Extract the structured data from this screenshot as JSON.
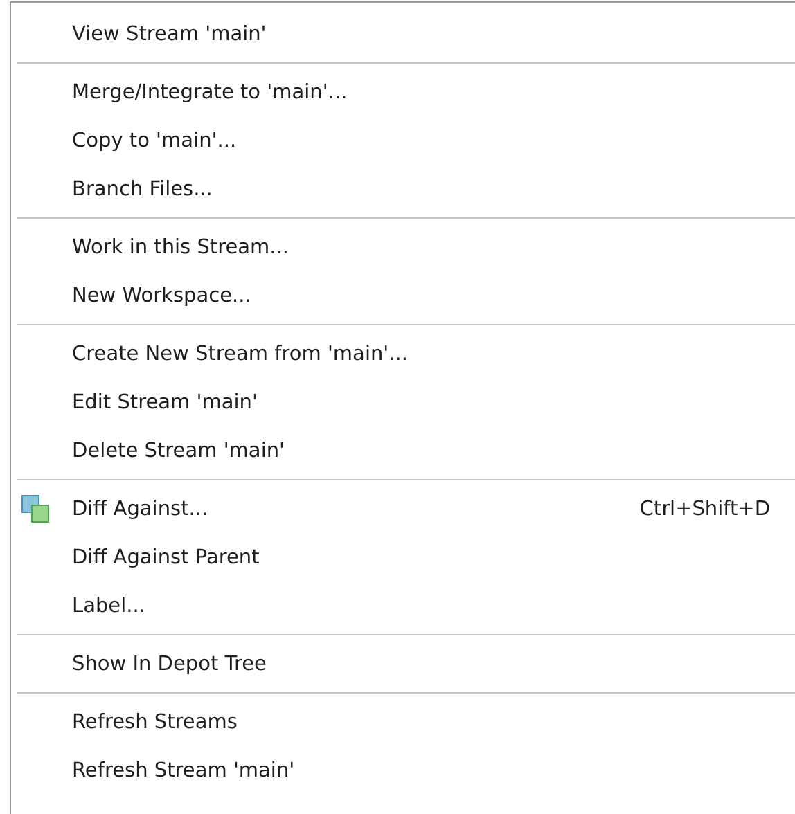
{
  "menu": {
    "items": [
      {
        "kind": "item",
        "label": "View Stream 'main'"
      },
      {
        "kind": "separator"
      },
      {
        "kind": "item",
        "label": "Merge/Integrate to 'main'..."
      },
      {
        "kind": "item",
        "label": "Copy to 'main'..."
      },
      {
        "kind": "item",
        "label": "Branch Files..."
      },
      {
        "kind": "separator"
      },
      {
        "kind": "item",
        "label": "Work in this Stream..."
      },
      {
        "kind": "item",
        "label": "New Workspace..."
      },
      {
        "kind": "separator"
      },
      {
        "kind": "item",
        "label": "Create New Stream from 'main'..."
      },
      {
        "kind": "item",
        "label": "Edit Stream 'main'"
      },
      {
        "kind": "item",
        "label": "Delete Stream 'main'"
      },
      {
        "kind": "separator"
      },
      {
        "kind": "icon-item",
        "label": "Diff Against...",
        "shortcut": "Ctrl+Shift+D"
      },
      {
        "kind": "item",
        "label": "Diff Against Parent"
      },
      {
        "kind": "item",
        "label": "Label..."
      },
      {
        "kind": "separator"
      },
      {
        "kind": "item",
        "label": "Show In Depot Tree"
      },
      {
        "kind": "separator"
      },
      {
        "kind": "item",
        "label": "Refresh Streams"
      },
      {
        "kind": "item",
        "label": "Refresh Stream 'main'"
      }
    ]
  }
}
